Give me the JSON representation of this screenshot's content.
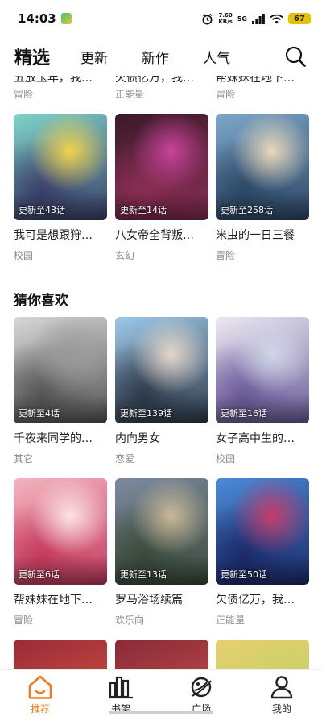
{
  "status_bar": {
    "time": "14:03",
    "speed_value": "7.60",
    "speed_unit": "KB/s",
    "network": "5G",
    "battery": "67"
  },
  "header": {
    "tabs": [
      {
        "label": "精选",
        "active": true
      },
      {
        "label": "更新",
        "active": false
      },
      {
        "label": "新作",
        "active": false
      },
      {
        "label": "人气",
        "active": false
      }
    ],
    "search_icon": "search-icon"
  },
  "top_partial": [
    {
      "title": "五放玉年，我…",
      "tag": "冒险"
    },
    {
      "title": "欠债亿万，我…",
      "tag": "正能量"
    },
    {
      "title": "帮妹妹在地下…",
      "tag": "冒险"
    }
  ],
  "row1": [
    {
      "title": "我可是想跟狩…",
      "tag": "校园",
      "update": "更新至43话",
      "colors": [
        "#7fd3c8",
        "#3a3f6b",
        "#f2d14a"
      ]
    },
    {
      "title": "八女帝全背叛…",
      "tag": "玄幻",
      "update": "更新至14话",
      "colors": [
        "#3b1a2a",
        "#8a2e54",
        "#c6449a"
      ]
    },
    {
      "title": "米虫的一日三餐",
      "tag": "冒险",
      "update": "更新至258话",
      "colors": [
        "#7ca6c9",
        "#2c4766",
        "#e9d8b8"
      ]
    }
  ],
  "guess_section": {
    "title": "猜你喜欢"
  },
  "row2": [
    {
      "title": "千夜来同学的…",
      "tag": "其它",
      "update": "更新至4话",
      "colors": [
        "#d8d8d8",
        "#555555",
        "#9a9a9a"
      ]
    },
    {
      "title": "内向男女",
      "tag": "恋爱",
      "update": "更新至139话",
      "colors": [
        "#9cc8e8",
        "#2f3a4a",
        "#e6d6c8"
      ]
    },
    {
      "title": "女子高中生的…",
      "tag": "校园",
      "update": "更新至16话",
      "colors": [
        "#ece9f2",
        "#6a5a9a",
        "#cfd6e6"
      ]
    }
  ],
  "row3": [
    {
      "title": "帮妹妹在地下…",
      "tag": "冒险",
      "update": "更新至6话",
      "colors": [
        "#f4b4bf",
        "#c53a5e",
        "#fbe3e6"
      ]
    },
    {
      "title": "罗马浴场续篇",
      "tag": "欢乐向",
      "update": "更新至13话",
      "colors": [
        "#7c8aa0",
        "#3a4a3a",
        "#c8b896"
      ]
    },
    {
      "title": "欠债亿万，我…",
      "tag": "正能量",
      "update": "更新至50话",
      "colors": [
        "#4a8ad8",
        "#1b2a6a",
        "#c33d6a"
      ]
    }
  ],
  "row4_colors": [
    [
      "#9a2a3a",
      "#e06040"
    ],
    [
      "#8a2a3a",
      "#d05a4a"
    ],
    [
      "#e8d070",
      "#a8d060"
    ]
  ],
  "bottom_nav": [
    {
      "label": "推荐",
      "icon": "home-icon",
      "active": true
    },
    {
      "label": "书架",
      "icon": "bookshelf-icon",
      "active": false
    },
    {
      "label": "广场",
      "icon": "planet-icon",
      "active": false
    },
    {
      "label": "我的",
      "icon": "user-icon",
      "active": false
    }
  ],
  "accent_color": "#f07a1e"
}
